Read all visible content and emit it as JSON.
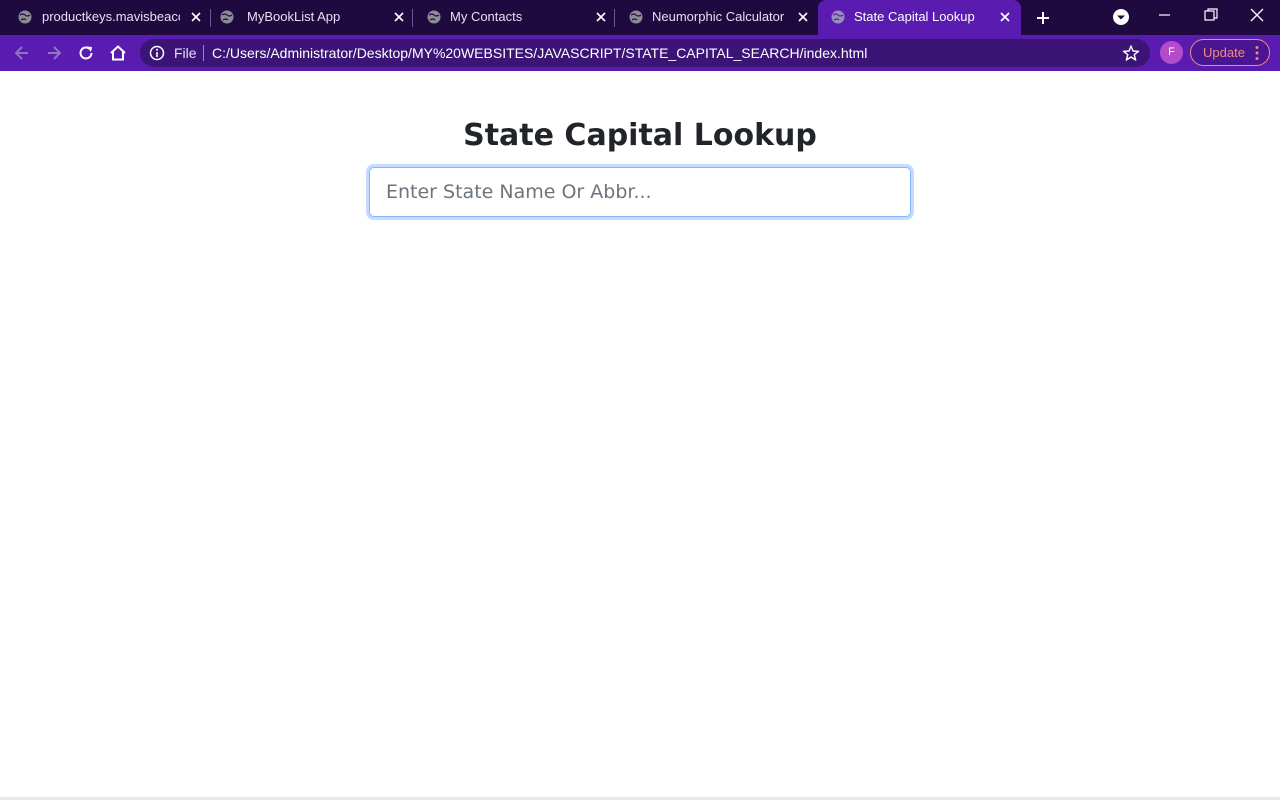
{
  "browser": {
    "tabs": [
      {
        "title": "productkeys.mavisbeacon",
        "active": false
      },
      {
        "title": "MyBookList App",
        "active": false
      },
      {
        "title": "My Contacts",
        "active": false
      },
      {
        "title": "Neumorphic Calculator",
        "active": false
      },
      {
        "title": "State Capital Lookup",
        "active": true
      }
    ],
    "address": {
      "scheme_label": "File",
      "url": "C:/Users/Administrator/Desktop/MY%20WEBSITES/JAVASCRIPT/STATE_CAPITAL_SEARCH/index.html"
    },
    "profile_initial": "F",
    "update_label": "Update",
    "colors": {
      "tabstrip": "#1f0a3f",
      "toolbar": "#5a1bb0",
      "omnibox": "#3b1476",
      "update_accent": "#f28b82",
      "avatar": "#b44bc8"
    }
  },
  "page": {
    "title": "State Capital Lookup",
    "search": {
      "placeholder": "Enter State Name Or Abbr...",
      "value": ""
    }
  },
  "icons": {
    "tab_favicon": "globe-icon",
    "tab_close": "close-icon",
    "new_tab": "plus-icon",
    "tab_search": "chevron-down-icon",
    "back": "arrow-left-icon",
    "forward": "arrow-right-icon",
    "reload": "reload-icon",
    "home": "home-icon",
    "site_info": "info-icon",
    "bookmark": "star-icon",
    "menu": "kebab-menu-icon"
  }
}
